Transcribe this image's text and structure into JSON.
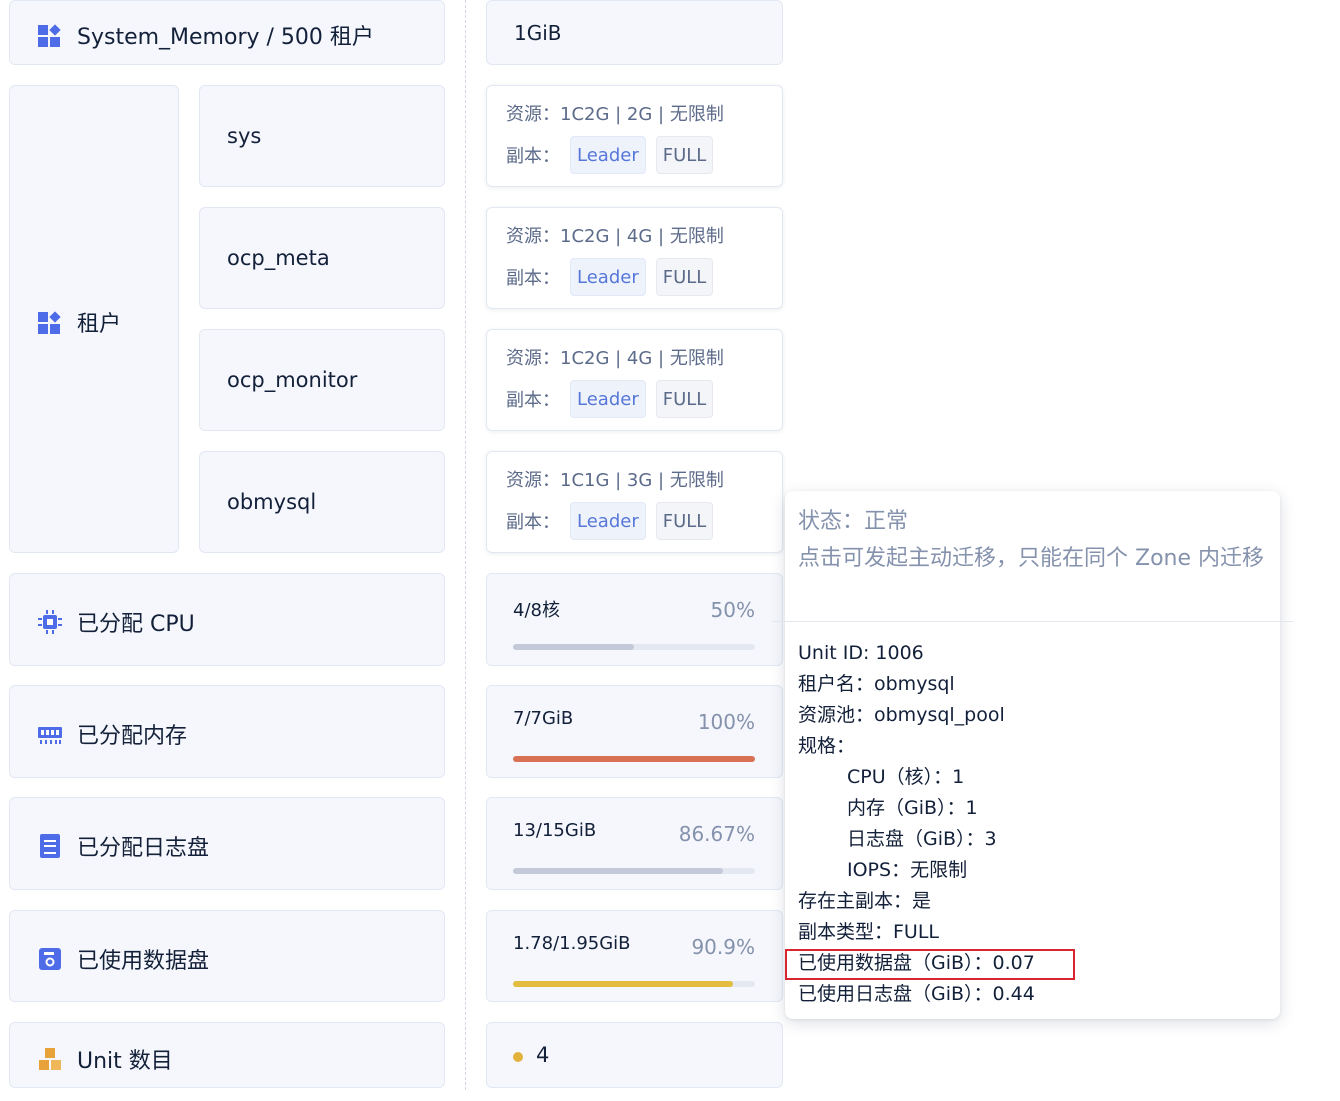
{
  "zone_header": {
    "label": "System_Memory / 500 租户",
    "memory_value": "1GiB"
  },
  "tenant_group": {
    "label": "租户"
  },
  "tenants": [
    {
      "name": "sys",
      "resource_label": "资源：",
      "resource": "1C2G | 2G | 无限制",
      "replica_label": "副本：",
      "role": "Leader",
      "type": "FULL"
    },
    {
      "name": "ocp_meta",
      "resource_label": "资源：",
      "resource": "1C2G | 4G | 无限制",
      "replica_label": "副本：",
      "role": "Leader",
      "type": "FULL"
    },
    {
      "name": "ocp_monitor",
      "resource_label": "资源：",
      "resource": "1C2G | 4G | 无限制",
      "replica_label": "副本：",
      "role": "Leader",
      "type": "FULL"
    },
    {
      "name": "obmysql",
      "resource_label": "资源：",
      "resource": "1C1G | 3G | 无限制",
      "replica_label": "副本：",
      "role": "Leader",
      "type": "FULL"
    }
  ],
  "stats": {
    "cpu": {
      "label": "已分配 CPU",
      "value": "4/8核",
      "percent": "50%",
      "fill": 0.5,
      "color": "#c5cadb"
    },
    "memory": {
      "label": "已分配内存",
      "value": "7/7GiB",
      "percent": "100%",
      "fill": 1.0,
      "color": "#d97155"
    },
    "log_disk": {
      "label": "已分配日志盘",
      "value": "13/15GiB",
      "percent": "86.67%",
      "fill": 0.8667,
      "color": "#c5cadb"
    },
    "data_disk": {
      "label": "已使用数据盘",
      "value": "1.78/1.95GiB",
      "percent": "90.9%",
      "fill": 0.909,
      "color": "#e3bd3f"
    },
    "unit_count": {
      "label": "Unit 数目",
      "value": "4",
      "dot_color": "#e3b23c"
    }
  },
  "tooltip": {
    "status": "状态：正常",
    "hint": "点击可发起主动迁移，只能在同个 Zone 内迁移",
    "unit_id": "Unit ID: 1006",
    "tenant_name": "租户名：obmysql",
    "pool": "资源池：obmysql_pool",
    "spec_label": "规格：",
    "spec_cpu": "CPU（核）：1",
    "spec_memory": "内存（GiB）：1",
    "spec_log": "日志盘（GiB）：3",
    "spec_iops": "IOPS：无限制",
    "has_leader": "存在主副本：是",
    "replica_type": "副本类型：FULL",
    "data_disk_used": "已使用数据盘（GiB）：0.07",
    "log_disk_used": "已使用日志盘（GiB）：0.44"
  },
  "colors": {
    "accent": "#4e6ce8",
    "text": "#132039",
    "muted": "#8592ad",
    "highlight_border": "#d8262f"
  }
}
